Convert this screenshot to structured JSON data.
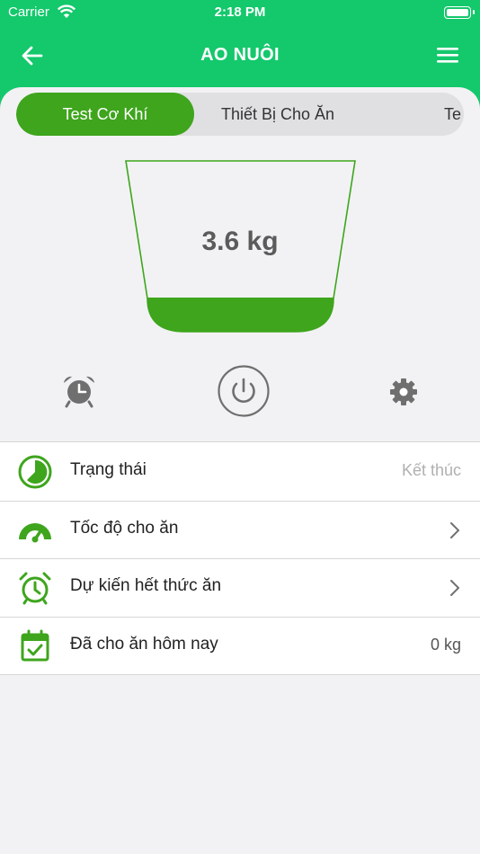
{
  "status_bar": {
    "carrier": "Carrier",
    "time": "2:18 PM"
  },
  "header": {
    "title": "AO NUÔI"
  },
  "tabs": [
    {
      "label": "Test Cơ Khí",
      "active": true
    },
    {
      "label": "Thiết Bị Cho Ăn",
      "active": false
    },
    {
      "label": "Te",
      "active": false
    }
  ],
  "feeder": {
    "weight_text": "3.6 kg",
    "fill_level": 0.2
  },
  "controls": {
    "alarm": "alarm-clock-icon",
    "power": "power-icon",
    "settings": "gear-icon"
  },
  "info_list": [
    {
      "label": "Trạng thái",
      "value": "Kết thúc"
    },
    {
      "label": "Tốc độ cho ăn",
      "value": ""
    },
    {
      "label": "Dự kiến hết thức ăn",
      "value": ""
    },
    {
      "label": "Đã cho ăn hôm nay",
      "value": "0 kg"
    }
  ],
  "colors": {
    "header": "#14c86c",
    "accent": "#3ea51d",
    "icon_gray": "#6f6f6f"
  }
}
